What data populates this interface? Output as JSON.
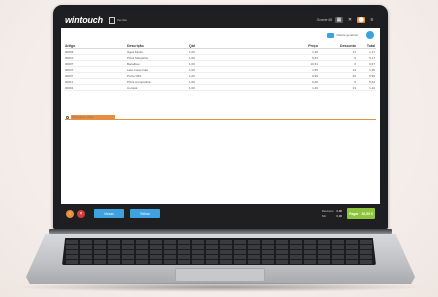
{
  "header": {
    "brand": "wintouch",
    "doc_label": "Vendas",
    "user_label": "Ocorrer 68",
    "buttons": [
      "▦",
      "✕",
      "⬤",
      "≡"
    ]
  },
  "client": {
    "label": "Cliente genérico"
  },
  "table": {
    "columns": [
      "Artigo",
      "Descrição",
      "Qtd",
      "Preço",
      "Desconto",
      "Total"
    ],
    "rows": [
      [
        "00003",
        "Água Fastio",
        "1,00",
        "1,35",
        "11",
        "1,17"
      ],
      [
        "00010",
        "Pizza Margarita",
        "1,00",
        "5,51",
        "6",
        "5,17"
      ],
      [
        "00007",
        "Bacalhau",
        "1,00",
        "10,61",
        "6",
        "9,97"
      ],
      [
        "00037",
        "Lata Coca-Cola",
        "1,00",
        "1,55",
        "13",
        "1,35"
      ],
      [
        "00007",
        "Ponto LBX",
        "1,00",
        "9,99",
        "25",
        "5,99"
      ],
      [
        "00011",
        "Pizza Companhia",
        "1,00",
        "6,00",
        "5",
        "5,64"
      ],
      [
        "00004",
        "Compal",
        "1,00",
        "1,40",
        "13",
        "1,22"
      ]
    ],
    "search_placeholder": "Pesquisar artigo"
  },
  "footer": {
    "buttons": [
      "Mesas",
      "Retirar"
    ],
    "totals": [
      {
        "label": "Desconto",
        "value": "0,00"
      },
      {
        "label": "IVA",
        "value": "0,00"
      }
    ],
    "pay_label": "Pagar",
    "pay_total": "30,50 €"
  },
  "colors": {
    "accent_orange": "#e98d3e",
    "accent_blue": "#3ea1e0",
    "pay_green": "#8cc43b",
    "cancel_red": "#d9383a",
    "bar_dark": "#1f1f22"
  }
}
